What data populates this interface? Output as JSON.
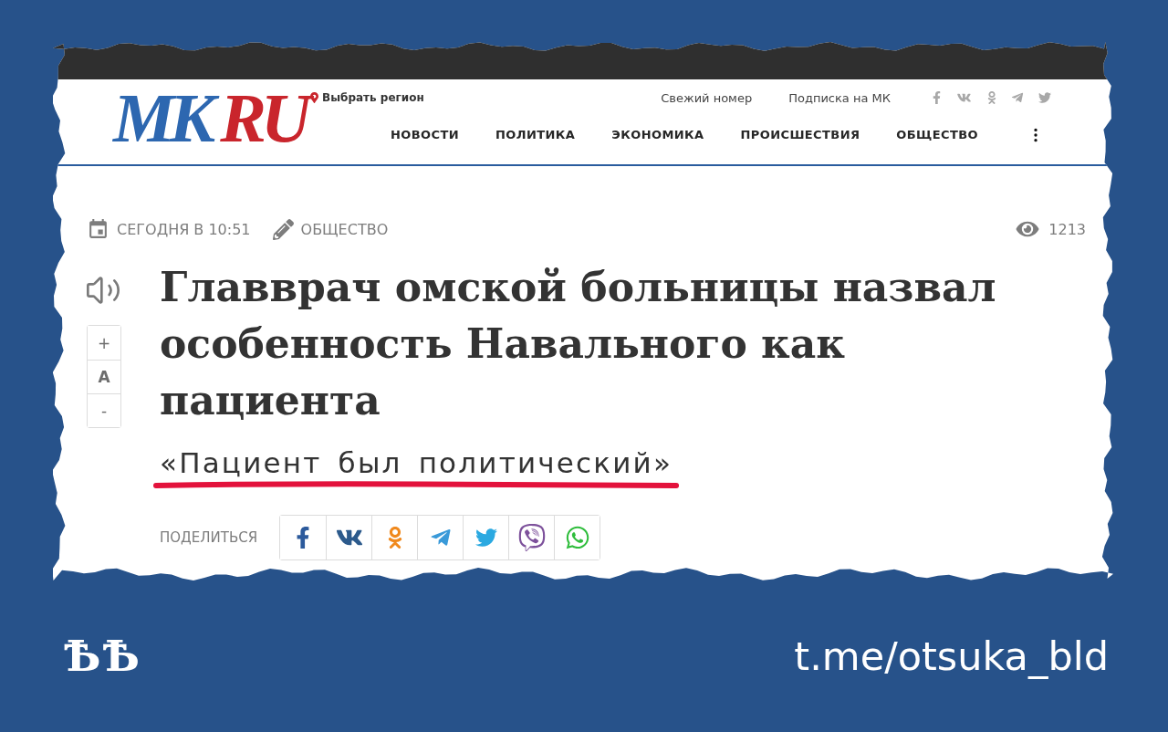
{
  "header": {
    "logo": [
      {
        "text": "MK",
        "color": "#2d67b0"
      },
      {
        "text": "RU",
        "color": "#c9252c"
      }
    ],
    "region_link": "Выбрать регион",
    "top_links": [
      "Свежий номер",
      "Подписка на МК"
    ],
    "nav": [
      "НОВОСТИ",
      "ПОЛИТИКА",
      "ЭКОНОМИКА",
      "ПРОИСШЕСТВИЯ",
      "ОБЩЕСТВО"
    ]
  },
  "article": {
    "meta": {
      "date": "СЕГОДНЯ В 10:51",
      "rubric": "ОБЩЕСТВО",
      "views": "1213"
    },
    "font_controls": [
      "+",
      "A",
      "-"
    ],
    "title": "Главврач омской больницы назвал особенность Навального как пациента",
    "subtitle": {
      "text": "«Пациент был политический»",
      "underlined": true
    },
    "share_label": "ПОДЕЛИТЬСЯ"
  },
  "footer": {
    "logo": "ѢѢ",
    "link": "t.me/otsuka_bld"
  }
}
